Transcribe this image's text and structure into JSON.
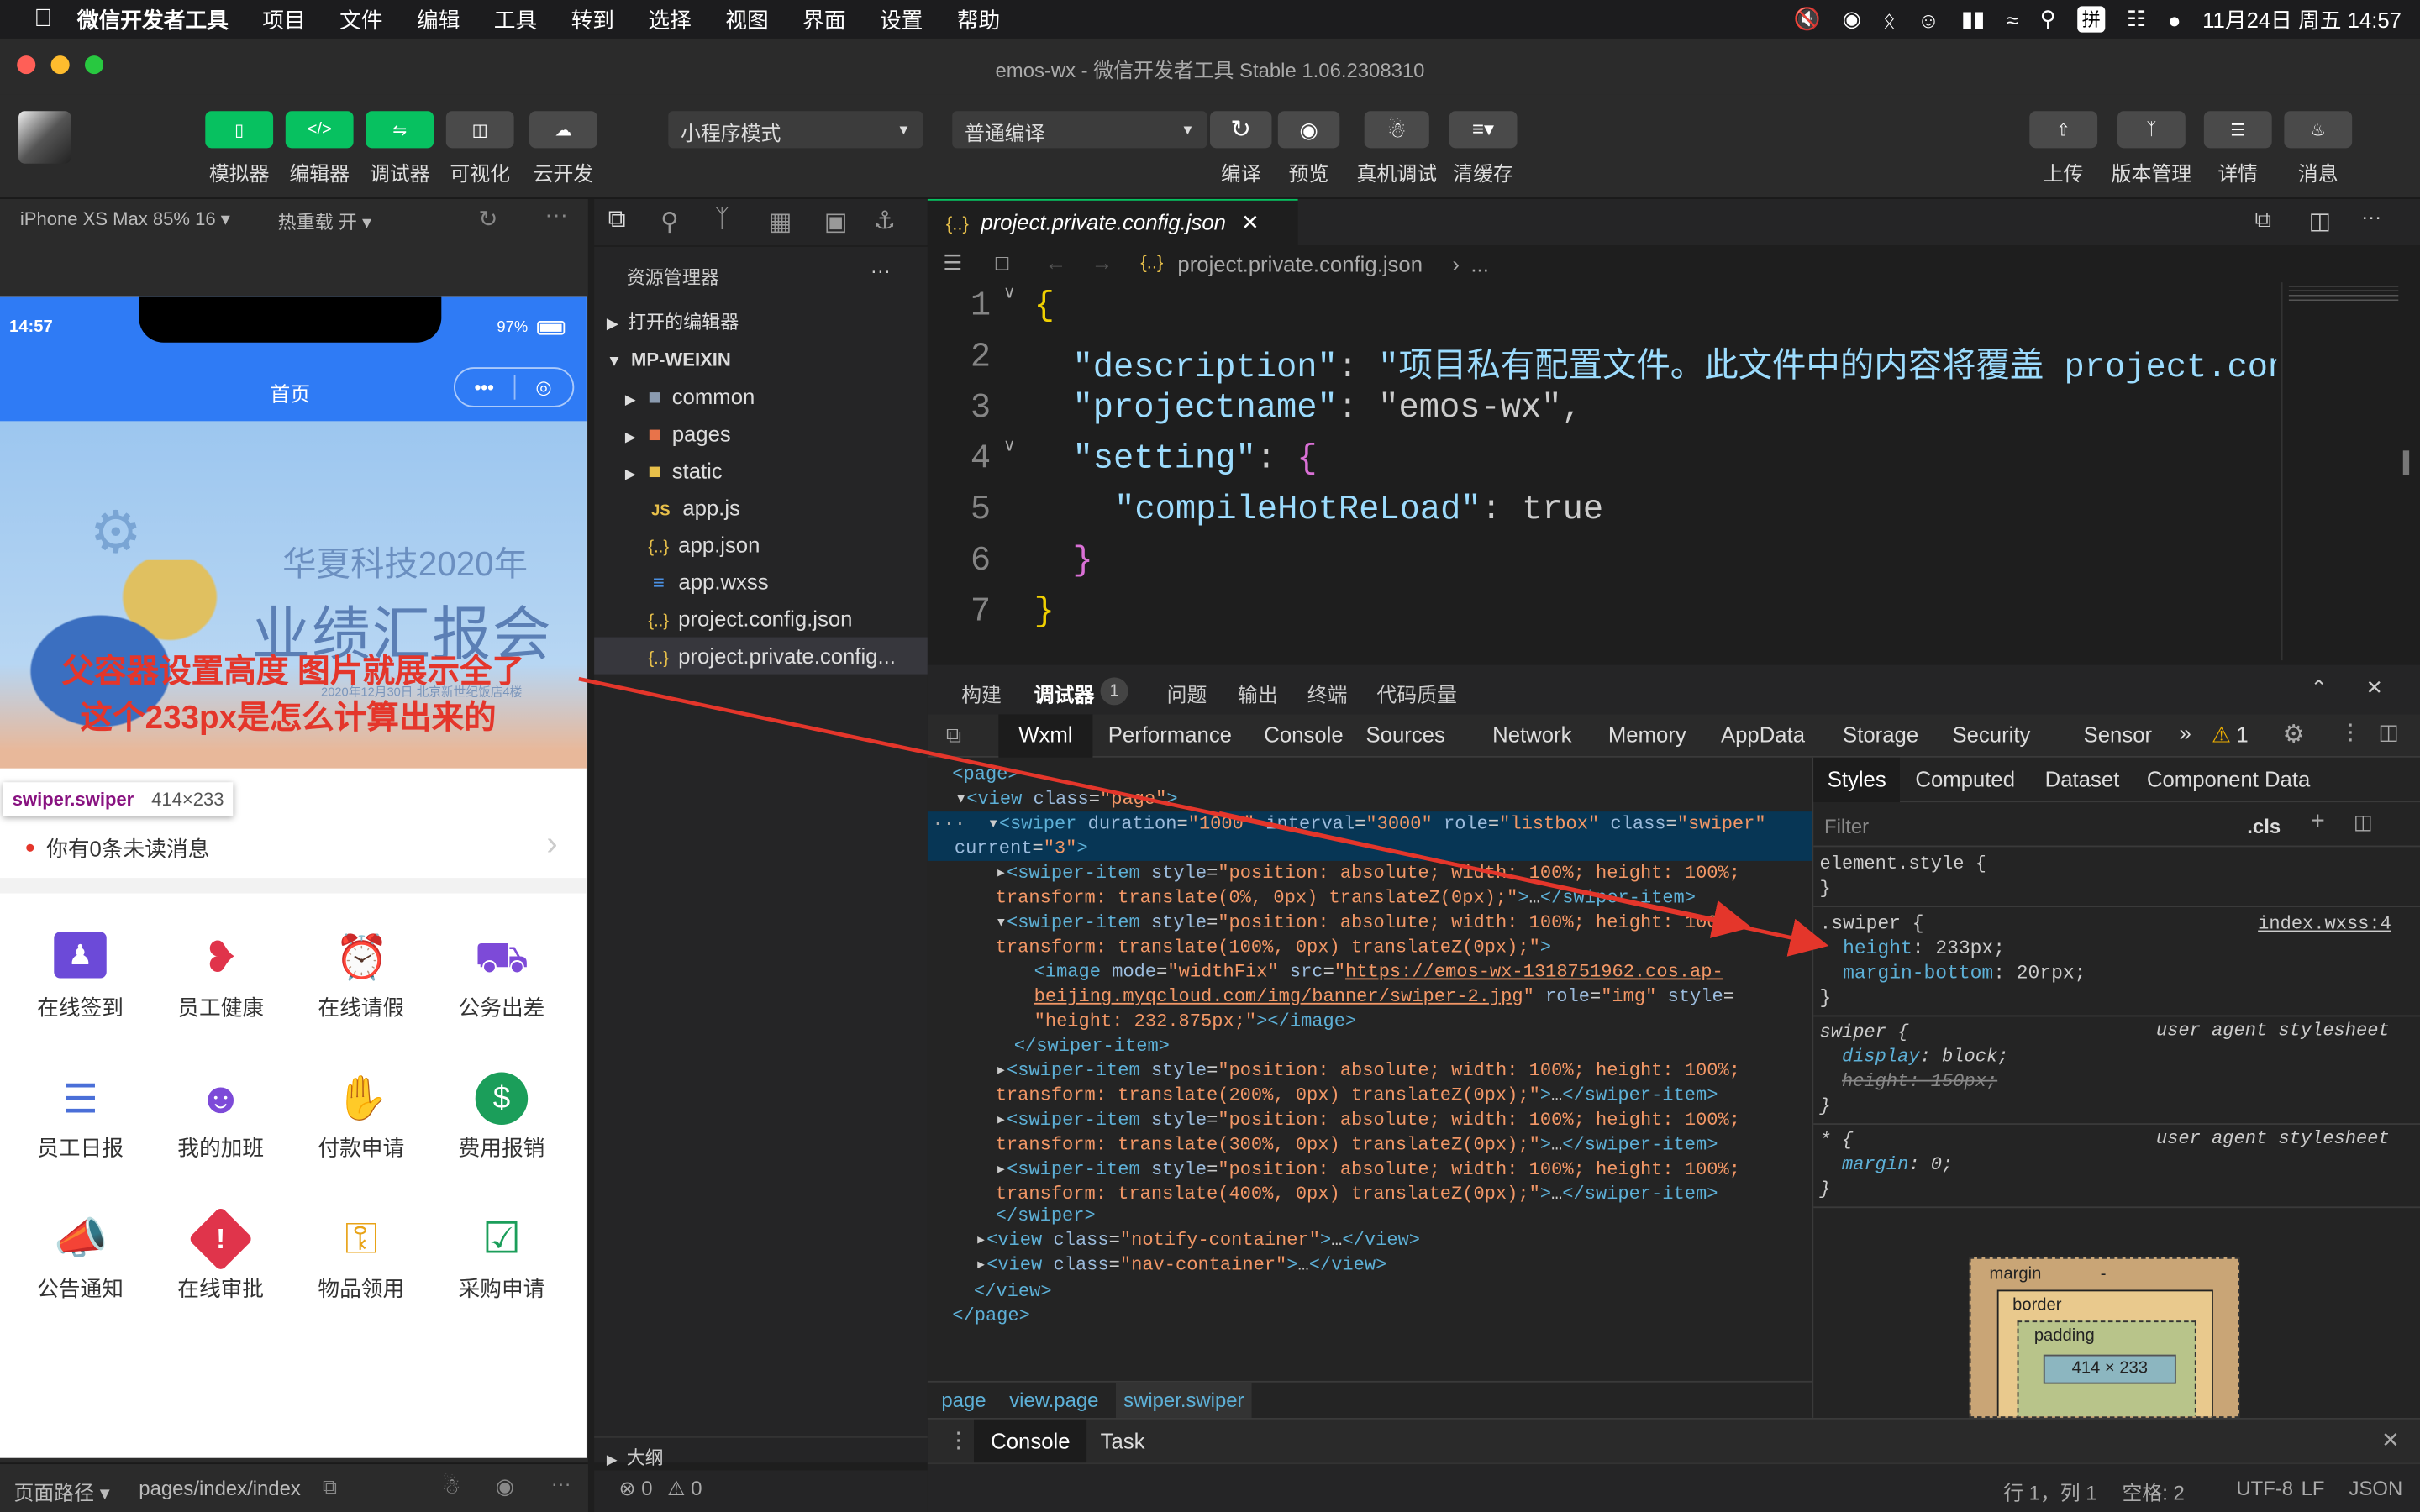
{
  "menubar": {
    "app": "微信开发者工具",
    "items": [
      "项目",
      "文件",
      "编辑",
      "工具",
      "转到",
      "选择",
      "视图",
      "界面",
      "设置",
      "帮助"
    ],
    "input_method": "拼",
    "datetime": "11月24日 周五  14:57"
  },
  "window": {
    "title": "emos-wx - 微信开发者工具 Stable 1.06.2308310"
  },
  "toolbar": {
    "buttons": [
      "模拟器",
      "编辑器",
      "调试器",
      "可视化",
      "云开发"
    ],
    "mode": "小程序模式",
    "compile_mode": "普通编译",
    "actions": [
      "编译",
      "预览",
      "真机调试",
      "清缓存"
    ],
    "right": [
      "上传",
      "版本管理",
      "详情",
      "消息"
    ]
  },
  "simulator": {
    "device": "iPhone XS Max 85% 16",
    "hotreload": "热重载 开",
    "time": "14:57",
    "battery": "97%",
    "nav_title": "首页",
    "banner_title": "华夏科技2020年",
    "banner_subtitle": "业绩汇报会",
    "banner_small": "2020年12月30日 北京新世纪饭店4楼",
    "annotation_line1": "父容器设置高度 图片就展示全了",
    "annotation_line2": "这个233px是怎么计算出来的",
    "tooltip_name": "swiper.swiper",
    "tooltip_size": "414×233",
    "notify": "你有0条未读消息",
    "grid": [
      "在线签到",
      "员工健康",
      "在线请假",
      "公务出差",
      "员工日报",
      "我的加班",
      "付款申请",
      "费用报销",
      "公告通知",
      "在线审批",
      "物品领用",
      "采购申请"
    ],
    "path_label": "页面路径",
    "path": "pages/index/index"
  },
  "explorer": {
    "title": "资源管理器",
    "open_editors": "打开的编辑器",
    "root": "MP-WEIXIN",
    "items": [
      "common",
      "pages",
      "static",
      "app.js",
      "app.json",
      "app.wxss",
      "project.config.json",
      "project.private.config..."
    ],
    "outline": "大纲",
    "problems": "0",
    "warnings": "0"
  },
  "editor": {
    "tab": "project.private.config.json",
    "breadcrumb": "project.private.config.json",
    "breadcrumb_more": "...",
    "lines": [
      "{",
      "\"description\": \"项目私有配置文件。此文件中的内容将覆盖 project.con",
      "\"projectname\": \"emos-wx\",",
      "\"setting\": {",
      "\"compileHotReLoad\": true",
      "}",
      "}"
    ]
  },
  "devtools": {
    "top_tabs": [
      "构建",
      "调试器",
      "问题",
      "输出",
      "终端",
      "代码质量"
    ],
    "debugger_badge": "1",
    "panels": [
      "Wxml",
      "Performance",
      "Console",
      "Sources",
      "Network",
      "Memory",
      "AppData",
      "Storage",
      "Security",
      "Sensor"
    ],
    "warn_count": "1",
    "style_tabs": [
      "Styles",
      "Computed",
      "Dataset",
      "Component Data"
    ],
    "filter": "Filter",
    "cls": ".cls",
    "crumbs": [
      "page",
      "view.page",
      "swiper.swiper"
    ],
    "console_tabs": [
      "Console",
      "Task"
    ],
    "box_model": {
      "margin": "margin",
      "border": "border",
      "padding": "padding",
      "content": "414 × 233",
      "dash": "-"
    }
  },
  "status": {
    "pos": "行 1，列 1",
    "spaces": "空格: 2",
    "encoding": "UTF-8",
    "eol": "LF",
    "lang": "JSON"
  },
  "colors": {
    "accent": "#07c160",
    "phone_blue": "#2f7bf5",
    "annotation": "#e4362b"
  }
}
